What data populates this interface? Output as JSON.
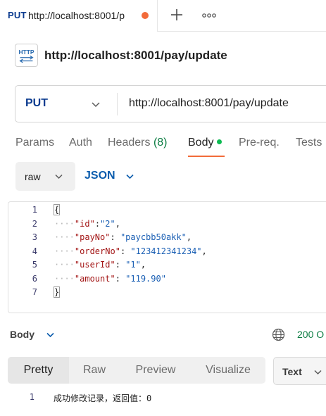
{
  "tab": {
    "method": "PUT",
    "url": "http://localhost:8001/p",
    "unsaved_color": "#f26b3a",
    "new_tab_icon": "plus-icon",
    "more_icon": "more-horizontal-icon"
  },
  "request": {
    "icon": "http-icon",
    "title": "http://localhost:8001/pay/update",
    "method": "PUT",
    "url": "http://localhost:8001/pay/update"
  },
  "request_tabs": {
    "params": "Params",
    "auth": "Auth",
    "headers": "Headers",
    "headers_count": "(8)",
    "body": "Body",
    "prereq": "Pre-req.",
    "tests": "Tests",
    "active": "Body"
  },
  "body_mode": {
    "mode": "raw",
    "language": "JSON"
  },
  "editor": {
    "line_numbers": [
      "1",
      "2",
      "3",
      "4",
      "5",
      "6",
      "7"
    ],
    "lines": {
      "l1": "{",
      "l2_key": "\"id\"",
      "l2_sep": ":",
      "l2_val": "\"2\"",
      "l2_end": ",",
      "l3_key": "\"payNo\"",
      "l3_sep": ": ",
      "l3_val": "\"paycbb50akk\"",
      "l3_end": ",",
      "l4_key": "\"orderNo\"",
      "l4_sep": ": ",
      "l4_val": "\"123412341234\"",
      "l4_end": ",",
      "l5_key": "\"userId\"",
      "l5_sep": ": ",
      "l5_val": "\"1\"",
      "l5_end": ",",
      "l6_key": "\"amount\"",
      "l6_sep": ": ",
      "l6_val": "\"119.90\"",
      "l7": "}",
      "indent": "····"
    }
  },
  "response": {
    "title": "Body",
    "status": "200 O",
    "status_color": "#0c7d43",
    "view_tabs": [
      "Pretty",
      "Raw",
      "Preview",
      "Visualize"
    ],
    "active_view": "Pretty",
    "format": "Text",
    "line_number": "1",
    "line": "成功修改记录，返回值：0"
  }
}
